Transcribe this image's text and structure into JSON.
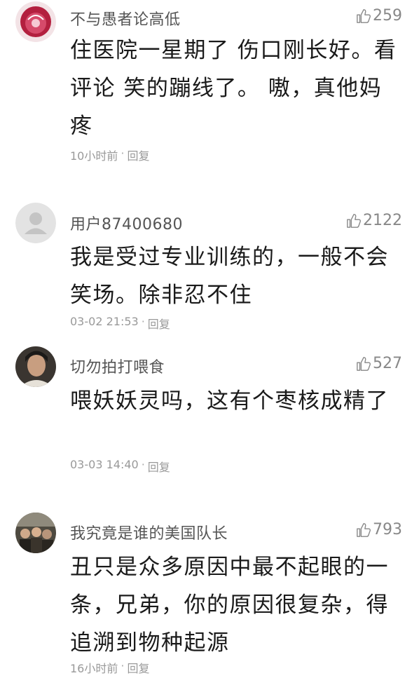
{
  "comments": [
    {
      "username": "不与愚者论高低",
      "likes": "259",
      "text": "住医院一星期了 伤口刚长好。看评论 笑的蹦线了。 嗷，真他妈疼",
      "time": "10小时前",
      "separator": "·",
      "reply": "回复",
      "avatar_icon": "pink-flower-avatar"
    },
    {
      "username": "用户87400680",
      "likes": "2122",
      "text": "我是受过专业训练的，一般不会笑场。除非忍不住",
      "time": "03-02 21:53",
      "separator": "·",
      "reply": "回复",
      "avatar_icon": "default-user-avatar"
    },
    {
      "username": "切勿拍打喂食",
      "likes": "527",
      "text": "喂妖妖灵吗，这有个枣核成精了",
      "time": "03-03 14:40",
      "separator": "·",
      "reply": "回复",
      "avatar_icon": "person-photo-avatar"
    },
    {
      "username": "我究竟是谁的美国队长",
      "likes": "793",
      "text": "丑只是众多原因中最不起眼的一条，兄弟，你的原因很复杂，得追溯到物种起源",
      "time": "16小时前",
      "separator": "·",
      "reply": "回复",
      "avatar_icon": "group-photo-avatar"
    }
  ],
  "colors": {
    "username": "#555555",
    "like": "#888888",
    "meta": "#999999",
    "text": "#1a1a1a"
  }
}
